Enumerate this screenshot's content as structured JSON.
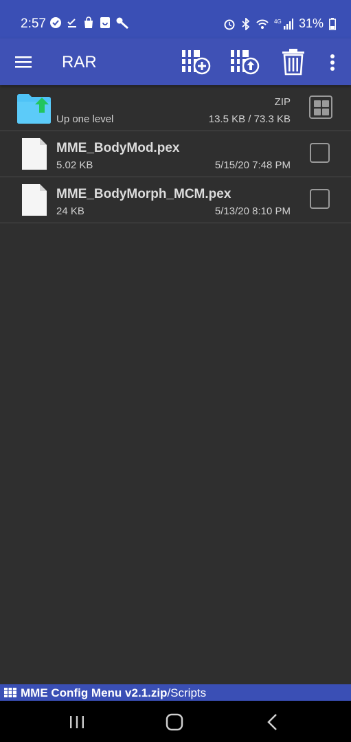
{
  "status_bar": {
    "time": "2:57",
    "battery": "31%",
    "left_icons": [
      "verified-check-icon",
      "checklist-icon",
      "shopping-bag-icon",
      "message-icon",
      "key-icon"
    ],
    "right_icons": [
      "alarm-icon",
      "bluetooth-icon",
      "wifi-icon",
      "lte-signal-icon",
      "battery-icon"
    ]
  },
  "toolbar": {
    "title": "RAR",
    "icons": [
      "menu-icon",
      "add-to-archive-icon",
      "extract-icon",
      "delete-icon",
      "more-options-icon"
    ]
  },
  "rows": [
    {
      "kind": "up",
      "name": "Up one level",
      "type": "ZIP",
      "size": "13.5 KB / 73.3 KB"
    },
    {
      "kind": "file",
      "name": "MME_BodyMod.pex",
      "size": "5.02 KB",
      "date": "5/15/20 7:48 PM"
    },
    {
      "kind": "file",
      "name": "MME_BodyMorph_MCM.pex",
      "size": "24 KB",
      "date": "5/13/20 8:10 PM"
    }
  ],
  "path_bar": {
    "archive": "MME Config Menu v2.1.zip",
    "subpath": "/Scripts"
  },
  "colors": {
    "status_bg": "#3a4fb5",
    "toolbar_bg": "#3f51b5",
    "list_bg": "#2f2f2f",
    "folder_blue": "#4fc3f7",
    "up_arrow_green": "#22c55e"
  }
}
